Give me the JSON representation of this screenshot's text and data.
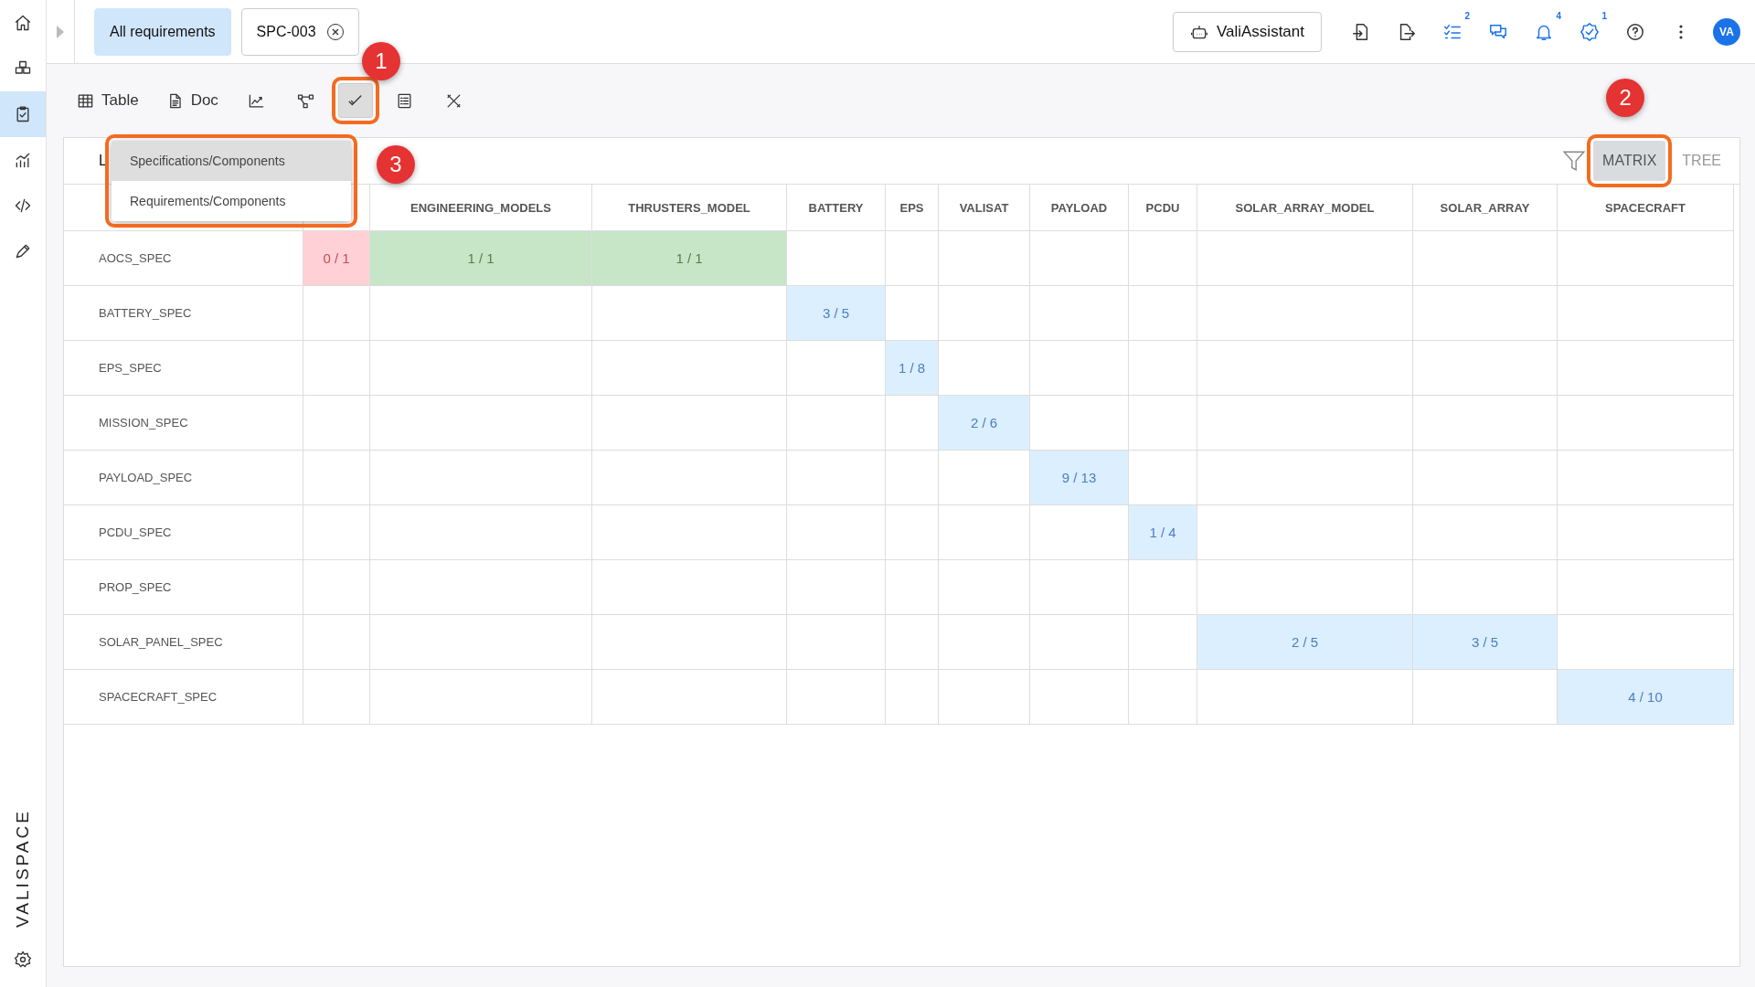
{
  "sidebar": {
    "items": [
      {
        "kind": "home",
        "selected": false
      },
      {
        "kind": "cubes",
        "selected": false
      },
      {
        "kind": "clipboard",
        "selected": true
      },
      {
        "kind": "chart",
        "selected": false
      },
      {
        "kind": "code",
        "selected": false
      },
      {
        "kind": "pen",
        "selected": false
      }
    ],
    "logo": "VALISPACE"
  },
  "tabs": [
    {
      "label": "All requirements",
      "selected": true,
      "closable": false
    },
    {
      "label": "SPC-003",
      "selected": false,
      "closable": true
    }
  ],
  "assistant_button": "ValiAssistant",
  "header_icons": [
    {
      "kind": "import"
    },
    {
      "kind": "export"
    },
    {
      "kind": "tasks",
      "badge": "2"
    },
    {
      "kind": "chat"
    },
    {
      "kind": "bell",
      "badge": "4"
    },
    {
      "kind": "verified",
      "badge": "1"
    },
    {
      "kind": "help"
    },
    {
      "kind": "more"
    }
  ],
  "avatar": "VA",
  "toolbar": [
    {
      "kind": "table",
      "label": "Table",
      "selected": false
    },
    {
      "kind": "doc",
      "label": "Doc",
      "selected": false
    },
    {
      "kind": "trend",
      "selected": false
    },
    {
      "kind": "graph",
      "selected": false
    },
    {
      "kind": "check",
      "selected": true,
      "callout": "1"
    },
    {
      "kind": "list",
      "selected": false
    },
    {
      "kind": "tools",
      "selected": false
    }
  ],
  "panel_title": "L",
  "dropdown": {
    "callout": "3",
    "items": [
      {
        "label": "Specifications/Components",
        "selected": true
      },
      {
        "label": "Requirements/Components",
        "selected": false
      }
    ]
  },
  "views": [
    {
      "label": "MATRIX",
      "selected": true,
      "callout": "2"
    },
    {
      "label": "TREE",
      "selected": false
    }
  ],
  "columns": [
    {
      "kind": "hidden"
    },
    {
      "kind": "label",
      "label": "ENGINEERING_MODELS"
    },
    {
      "kind": "label",
      "label": "THRUSTERS_MODEL"
    },
    {
      "kind": "label",
      "label": "BATTERY"
    },
    {
      "kind": "label",
      "label": "EPS"
    },
    {
      "kind": "label",
      "label": "VALISAT"
    },
    {
      "kind": "label",
      "label": "PAYLOAD"
    },
    {
      "kind": "label",
      "label": "PCDU"
    },
    {
      "kind": "label",
      "label": "SOLAR_ARRAY_MODEL"
    },
    {
      "kind": "label",
      "label": "SOLAR_ARRAY"
    },
    {
      "kind": "label",
      "label": "SPACECRAFT"
    }
  ],
  "rows": [
    {
      "label": "AOCS_SPEC",
      "cells": [
        {
          "kind": "count",
          "text": "0 / 1",
          "color": "#ffd1d6"
        },
        {
          "kind": "count",
          "text": "1 / 1",
          "color": "#c7e6c8"
        },
        {
          "kind": "count",
          "text": "1 / 1",
          "color": "#c7e6c8"
        },
        {
          "kind": "empty"
        },
        {
          "kind": "empty"
        },
        {
          "kind": "empty"
        },
        {
          "kind": "empty"
        },
        {
          "kind": "empty"
        },
        {
          "kind": "empty"
        },
        {
          "kind": "empty"
        },
        {
          "kind": "empty"
        }
      ]
    },
    {
      "label": "BATTERY_SPEC",
      "cells": [
        {
          "kind": "empty"
        },
        {
          "kind": "empty"
        },
        {
          "kind": "empty"
        },
        {
          "kind": "count",
          "text": "3 / 5",
          "color": "#dcefff"
        },
        {
          "kind": "empty"
        },
        {
          "kind": "empty"
        },
        {
          "kind": "empty"
        },
        {
          "kind": "empty"
        },
        {
          "kind": "empty"
        },
        {
          "kind": "empty"
        },
        {
          "kind": "empty"
        }
      ]
    },
    {
      "label": "EPS_SPEC",
      "cells": [
        {
          "kind": "empty"
        },
        {
          "kind": "empty"
        },
        {
          "kind": "empty"
        },
        {
          "kind": "empty"
        },
        {
          "kind": "count",
          "text": "1 / 8",
          "color": "#dcefff"
        },
        {
          "kind": "empty"
        },
        {
          "kind": "empty"
        },
        {
          "kind": "empty"
        },
        {
          "kind": "empty"
        },
        {
          "kind": "empty"
        },
        {
          "kind": "empty"
        }
      ]
    },
    {
      "label": "MISSION_SPEC",
      "cells": [
        {
          "kind": "empty"
        },
        {
          "kind": "empty"
        },
        {
          "kind": "empty"
        },
        {
          "kind": "empty"
        },
        {
          "kind": "empty"
        },
        {
          "kind": "count",
          "text": "2 / 6",
          "color": "#dcefff"
        },
        {
          "kind": "empty"
        },
        {
          "kind": "empty"
        },
        {
          "kind": "empty"
        },
        {
          "kind": "empty"
        },
        {
          "kind": "empty"
        }
      ]
    },
    {
      "label": "PAYLOAD_SPEC",
      "cells": [
        {
          "kind": "empty"
        },
        {
          "kind": "empty"
        },
        {
          "kind": "empty"
        },
        {
          "kind": "empty"
        },
        {
          "kind": "empty"
        },
        {
          "kind": "empty"
        },
        {
          "kind": "count",
          "text": "9 / 13",
          "color": "#dcefff"
        },
        {
          "kind": "empty"
        },
        {
          "kind": "empty"
        },
        {
          "kind": "empty"
        },
        {
          "kind": "empty"
        }
      ]
    },
    {
      "label": "PCDU_SPEC",
      "cells": [
        {
          "kind": "empty"
        },
        {
          "kind": "empty"
        },
        {
          "kind": "empty"
        },
        {
          "kind": "empty"
        },
        {
          "kind": "empty"
        },
        {
          "kind": "empty"
        },
        {
          "kind": "empty"
        },
        {
          "kind": "count",
          "text": "1 / 4",
          "color": "#dcefff"
        },
        {
          "kind": "empty"
        },
        {
          "kind": "empty"
        },
        {
          "kind": "empty"
        }
      ]
    },
    {
      "label": "PROP_SPEC",
      "cells": [
        {
          "kind": "empty"
        },
        {
          "kind": "empty"
        },
        {
          "kind": "empty"
        },
        {
          "kind": "empty"
        },
        {
          "kind": "empty"
        },
        {
          "kind": "empty"
        },
        {
          "kind": "empty"
        },
        {
          "kind": "empty"
        },
        {
          "kind": "empty"
        },
        {
          "kind": "empty"
        },
        {
          "kind": "empty"
        }
      ]
    },
    {
      "label": "SOLAR_PANEL_SPEC",
      "cells": [
        {
          "kind": "empty"
        },
        {
          "kind": "empty"
        },
        {
          "kind": "empty"
        },
        {
          "kind": "empty"
        },
        {
          "kind": "empty"
        },
        {
          "kind": "empty"
        },
        {
          "kind": "empty"
        },
        {
          "kind": "empty"
        },
        {
          "kind": "count",
          "text": "2 / 5",
          "color": "#dcefff"
        },
        {
          "kind": "count",
          "text": "3 / 5",
          "color": "#dcefff"
        },
        {
          "kind": "empty"
        }
      ]
    },
    {
      "label": "SPACECRAFT_SPEC",
      "cells": [
        {
          "kind": "empty"
        },
        {
          "kind": "empty"
        },
        {
          "kind": "empty"
        },
        {
          "kind": "empty"
        },
        {
          "kind": "empty"
        },
        {
          "kind": "empty"
        },
        {
          "kind": "empty"
        },
        {
          "kind": "empty"
        },
        {
          "kind": "empty"
        },
        {
          "kind": "empty"
        },
        {
          "kind": "count",
          "text": "4 / 10",
          "color": "#dcefff"
        }
      ]
    }
  ]
}
